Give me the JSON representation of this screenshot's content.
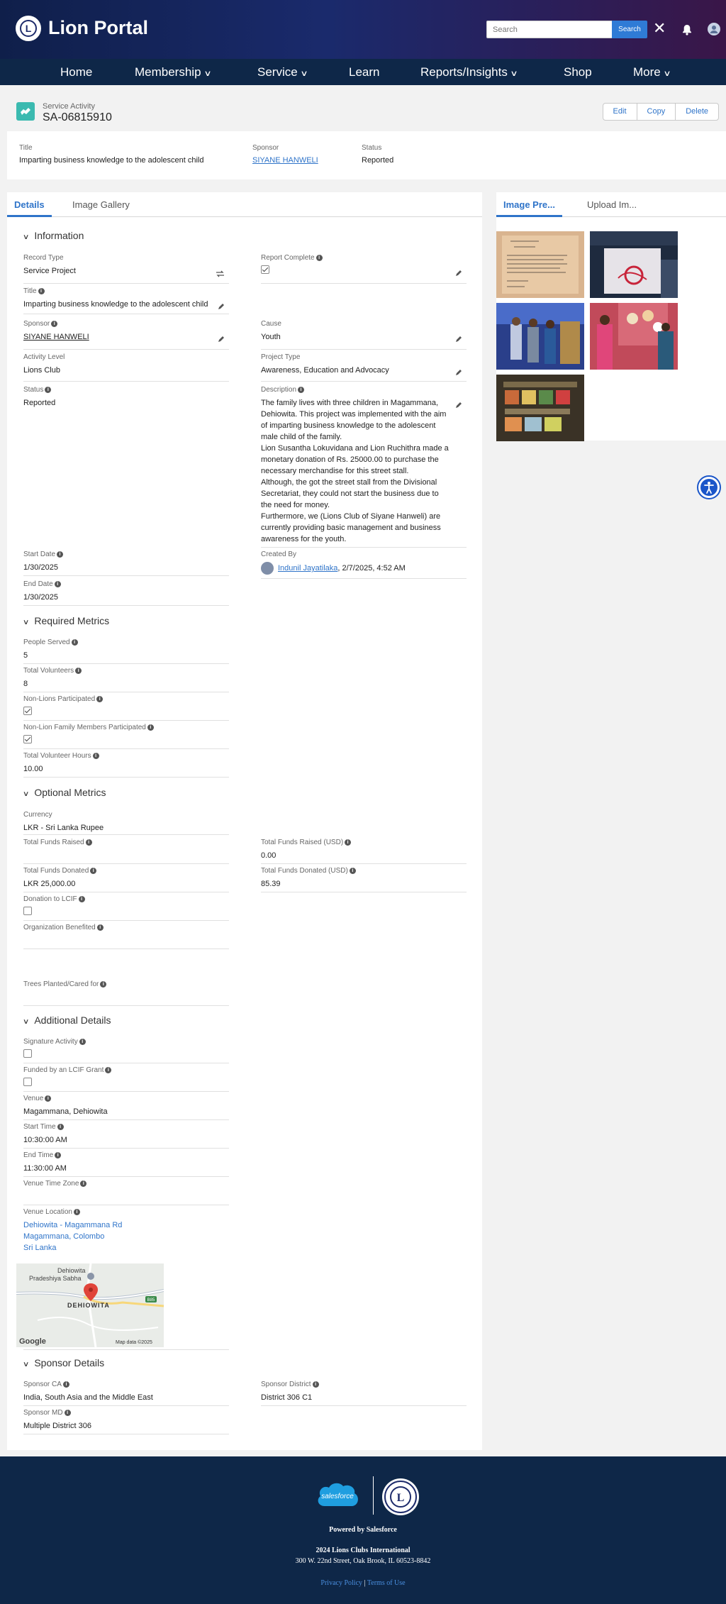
{
  "header": {
    "brand": "Lion Portal",
    "search_placeholder": "Search",
    "search_button": "Search"
  },
  "nav": [
    {
      "label": "Home",
      "dropdown": false
    },
    {
      "label": "Membership",
      "dropdown": true
    },
    {
      "label": "Service",
      "dropdown": true
    },
    {
      "label": "Learn",
      "dropdown": false
    },
    {
      "label": "Reports/Insights",
      "dropdown": true
    },
    {
      "label": "Shop",
      "dropdown": false
    },
    {
      "label": "More",
      "dropdown": true
    }
  ],
  "record": {
    "type": "Service Activity",
    "name": "SA-06815910",
    "buttons": [
      "Edit",
      "Copy",
      "Delete"
    ],
    "highlights": {
      "title_label": "Title",
      "title": "Imparting business knowledge to the adolescent child",
      "sponsor_label": "Sponsor",
      "sponsor": "SIYANE HANWELI",
      "status_label": "Status",
      "status": "Reported"
    }
  },
  "tabs": {
    "left": [
      "Details",
      "Image Gallery"
    ],
    "right": [
      "Image Pre...",
      "Upload Im..."
    ]
  },
  "sections": {
    "information": "Information",
    "required": "Required Metrics",
    "optional": "Optional Metrics",
    "additional": "Additional Details",
    "sponsor": "Sponsor Details"
  },
  "info": {
    "record_type_label": "Record Type",
    "record_type": "Service Project",
    "report_complete_label": "Report Complete",
    "title_label": "Title",
    "title": "Imparting business knowledge to the adolescent child",
    "sponsor_label": "Sponsor",
    "sponsor": "SIYANE HANWELI",
    "cause_label": "Cause",
    "cause": "Youth",
    "activity_level_label": "Activity Level",
    "activity_level": "Lions Club",
    "project_type_label": "Project Type",
    "project_type": "Awareness, Education and Advocacy",
    "status_label": "Status",
    "status": "Reported",
    "description_label": "Description",
    "description": "The family lives with three children in Magammana, Dehiowita. This project was implemented with the aim of imparting business knowledge to the adolescent male child of the family.\nLion Susantha Lokuvidana and Lion Ruchithra made a monetary donation of Rs. 25000.00 to purchase the necessary merchandise for this street stall.\nAlthough, the got the street stall from the Divisional Secretariat, they could not start the business due to the need for money.\nFurthermore, we (Lions Club of Siyane Hanweli) are currently providing basic management and business awareness for the youth.",
    "start_date_label": "Start Date",
    "start_date": "1/30/2025",
    "created_by_label": "Created By",
    "created_by": "Indunil Jayatilaka",
    "created_at": ", 2/7/2025, 4:52 AM",
    "end_date_label": "End Date",
    "end_date": "1/30/2025"
  },
  "required": {
    "people_served_label": "People Served",
    "people_served": "5",
    "total_volunteers_label": "Total Volunteers",
    "total_volunteers": "8",
    "non_lions_label": "Non-Lions Participated",
    "non_lions_checked": true,
    "non_lion_family_label": "Non-Lion Family Members Participated",
    "non_lion_family_checked": true,
    "volunteer_hours_label": "Total Volunteer Hours",
    "volunteer_hours": "10.00"
  },
  "optional": {
    "currency_label": "Currency",
    "currency": "LKR - Sri Lanka Rupee",
    "funds_raised_label": "Total Funds Raised",
    "funds_raised": "",
    "funds_raised_usd_label": "Total Funds Raised (USD)",
    "funds_raised_usd": "0.00",
    "funds_donated_label": "Total Funds Donated",
    "funds_donated": "LKR 25,000.00",
    "funds_donated_usd_label": "Total Funds Donated (USD)",
    "funds_donated_usd": "85.39",
    "donation_lcif_label": "Donation to LCIF",
    "donation_lcif_checked": false,
    "org_benefited_label": "Organization Benefited",
    "trees_label": "Trees Planted/Cared for"
  },
  "additional": {
    "signature_label": "Signature Activity",
    "signature_checked": false,
    "lcif_grant_label": "Funded by an LCIF Grant",
    "lcif_grant_checked": false,
    "venue_label": "Venue",
    "venue": "Magammana, Dehiowita",
    "start_time_label": "Start Time",
    "start_time": "10:30:00 AM",
    "end_time_label": "End Time",
    "end_time": "11:30:00 AM",
    "venue_tz_label": "Venue Time Zone",
    "venue_location_label": "Venue Location",
    "venue_location": [
      "Dehiowita - Magammana Rd",
      "Magammana, Colombo",
      "Sri Lanka"
    ],
    "map": {
      "place1": "Dehiowita",
      "place2": "Pradeshiya Sabha",
      "place3": "DEHIOWITA",
      "road": "B85",
      "logo": "Google",
      "credit": "Map data ©2025"
    }
  },
  "sponsor_details": {
    "ca_label": "Sponsor CA",
    "ca": "India, South Asia and the Middle East",
    "district_label": "Sponsor District",
    "district": "District 306 C1",
    "md_label": "Sponsor MD",
    "md": "Multiple District 306"
  },
  "footer": {
    "sf_logo": "salesforce",
    "lion_mark": "L",
    "powered": "Powered by Salesforce",
    "copyright": "2024 Lions Clubs International",
    "address": "300 W. 22nd Street, Oak Brook, IL 60523-8842",
    "privacy": "Privacy Policy",
    "sep": "|",
    "terms": "Terms of Use"
  },
  "logo_letter": "L",
  "colors": {
    "accent": "#2f74c9",
    "nav": "#0e2748",
    "record_icon": "#3bbab0"
  }
}
